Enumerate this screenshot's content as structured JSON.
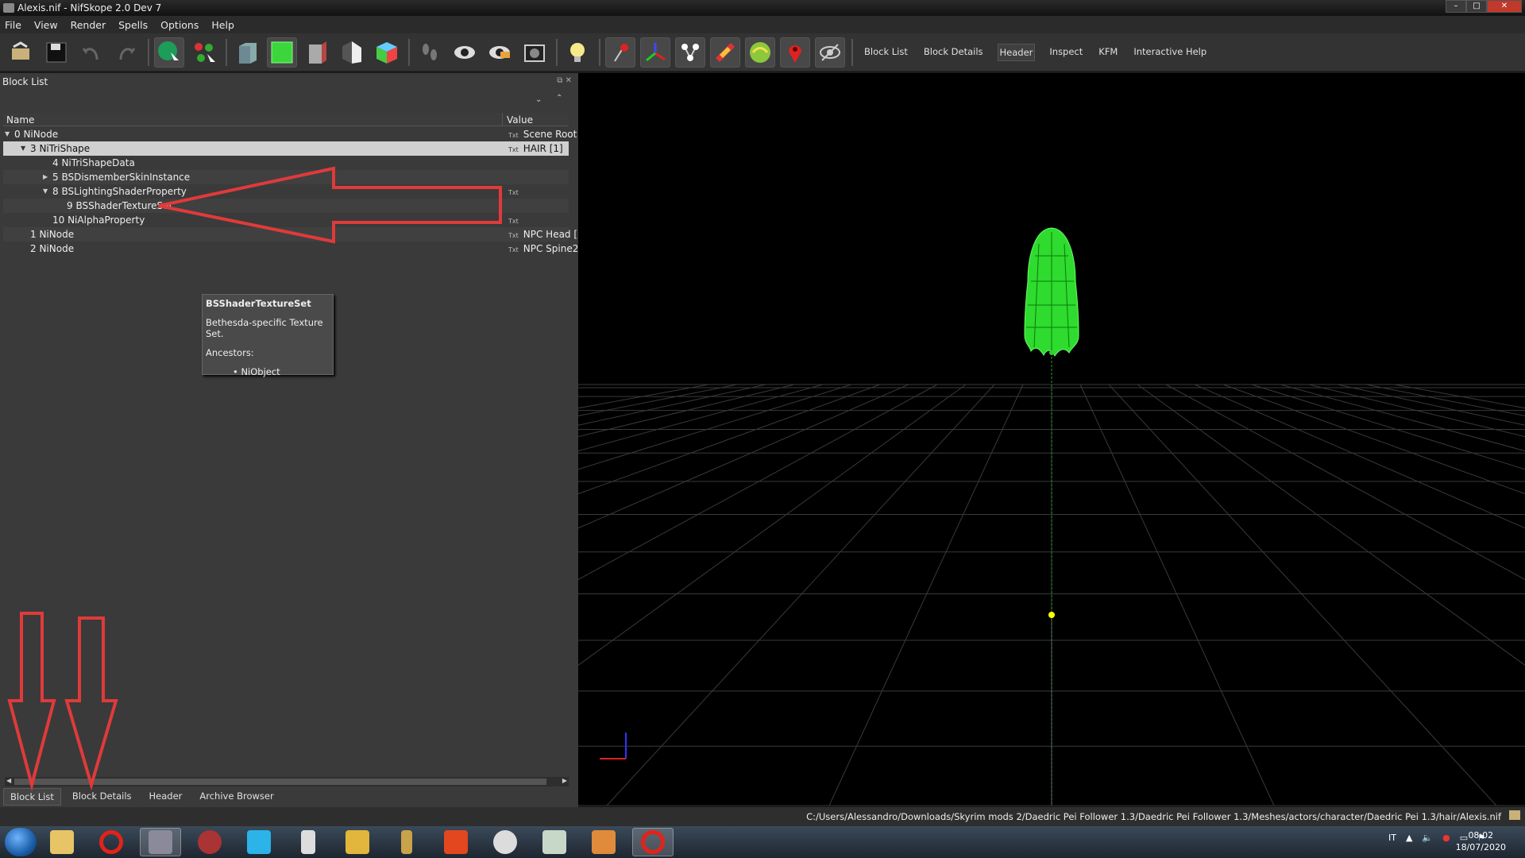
{
  "window": {
    "title": "Alexis.nif - NifSkope 2.0 Dev 7",
    "controls": [
      "minimize",
      "maximize",
      "close"
    ]
  },
  "menu": [
    "File",
    "View",
    "Render",
    "Spells",
    "Options",
    "Help"
  ],
  "toolbar": {
    "icons": [
      "load-icon",
      "save-icon",
      "undo-icon",
      "redo-icon",
      "select-object-icon",
      "select-vertex-icon",
      "view-front-icon",
      "view-top-icon",
      "view-side-icon",
      "view-flip-icon",
      "view-user-icon",
      "walk-icon",
      "show-icon",
      "hide-icon",
      "screenshot-icon",
      "light-icon",
      "node-icon",
      "axes-icon",
      "connections-icon",
      "stripes-icon",
      "constraints-icon",
      "markers-icon",
      "hidden-icon"
    ],
    "tabs": [
      "Block List",
      "Block Details",
      "Header",
      "Inspect",
      "KFM",
      "Interactive Help"
    ]
  },
  "block_list": {
    "title": "Block List",
    "columns": {
      "name": "Name",
      "value": "Value"
    },
    "rows": [
      {
        "name": "0 NiNode",
        "value": "Scene Root",
        "indent": 0,
        "expander": "open",
        "txt": true
      },
      {
        "name": "3 NiTriShape",
        "value": "HAIR [1]",
        "indent": 1,
        "expander": "open",
        "txt": true,
        "selected": true
      },
      {
        "name": "4 NiTriShapeData",
        "value": "",
        "indent": 2,
        "expander": "none",
        "txt": false
      },
      {
        "name": "5 BSDismemberSkinInstance",
        "value": "",
        "indent": 2,
        "expander": "closed",
        "txt": false
      },
      {
        "name": "8 BSLightingShaderProperty",
        "value": "",
        "indent": 2,
        "expander": "open",
        "txt": true
      },
      {
        "name": "9 BSShaderTextureSet",
        "value": "",
        "indent": 3,
        "expander": "none",
        "txt": false
      },
      {
        "name": "10 NiAlphaProperty",
        "value": "",
        "indent": 2,
        "expander": "none",
        "txt": true
      },
      {
        "name": "1 NiNode",
        "value": "NPC Head [",
        "indent": 1,
        "expander": "none",
        "txt": true
      },
      {
        "name": "2 NiNode",
        "value": "NPC Spine2",
        "indent": 1,
        "expander": "none",
        "txt": true
      }
    ],
    "txt_label": "Txt"
  },
  "tooltip": {
    "title": "BSShaderTextureSet",
    "description": "Bethesda-specific Texture Set.",
    "ancestors_label": "Ancestors:",
    "ancestor": "• NiObject"
  },
  "bottom_tabs": [
    "Block List",
    "Block Details",
    "Header",
    "Archive Browser"
  ],
  "status": {
    "path": "C:/Users/Alessandro/Downloads/Skyrim mods 2/Daedric Pei Follower 1.3/Daedric Pei Follower 1.3/Meshes/actors/character/Daedric Pei 1.3/hair/Alexis.nif"
  },
  "taskbar": {
    "apps": [
      "explorer-icon",
      "opera-icon",
      "media-icon",
      "game-icon",
      "itunes-icon",
      "cursor-icon",
      "folder-icon",
      "arrow-app-icon",
      "f-app-icon",
      "ff-dec-icon",
      "window-app-icon",
      "x-app-icon",
      "opera-active-icon"
    ],
    "language": "IT",
    "time": "08:02",
    "date": "18/07/2020"
  },
  "colors": {
    "accent_red": "#e03a3a",
    "mesh_green": "#33ff33",
    "selection": "#d0d0d0"
  }
}
